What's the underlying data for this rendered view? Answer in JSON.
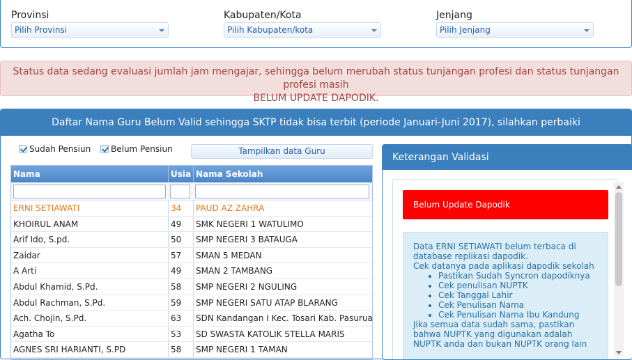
{
  "filters": {
    "provinsi": {
      "label": "Provinsi",
      "value": "Pilih Provinsi"
    },
    "kabupaten": {
      "label": "Kabupaten/Kota",
      "value": "Pilih Kabupaten/kota"
    },
    "jenjang": {
      "label": "Jenjang",
      "value": "Pilih Jenjang"
    }
  },
  "alert": {
    "line1": "Status data sedang evaluasi jumlah jam mengajar, sehingga belum merubah status tunjangan profesi dan status tunjangan profesi masih",
    "line2": "BELUM UPDATE DAPODIK."
  },
  "main": {
    "title": "Daftar Nama Guru Belum Valid sehingga SKTP tidak bisa terbit (periode Januari-Juni 2017), silahkan perbaiki",
    "checkbox_sudah": "Sudah Pensiun",
    "checkbox_belum": "Belum Pensiun",
    "button": "Tampilkan data Guru"
  },
  "table": {
    "columns": [
      "Nama",
      "Usia",
      "Nama Sekolah"
    ],
    "rows": [
      [
        "ERNI SETIAWATI",
        "34",
        "PAUD AZ ZAHRA"
      ],
      [
        "KHOIRUL ANAM",
        "49",
        "SMK NEGERI 1 WATULIMO"
      ],
      [
        "Arif Ido, S.pd.",
        "50",
        "SMP NEGERI 3 BATAUGA"
      ],
      [
        "Zaidar",
        "57",
        "SMAN 5 MEDAN"
      ],
      [
        "A Arti",
        "49",
        "SMAN 2 TAMBANG"
      ],
      [
        "Abdul Khamid, S.Pd.",
        "58",
        "SMP NEGERI 2 NGULING"
      ],
      [
        "Abdul Rachman, S.Pd.",
        "59",
        "SMP NEGERI SATU ATAP BLARANG"
      ],
      [
        "Ach. Chojin, S.Pd.",
        "63",
        "SDN Kandangan I Kec. Tosari Kab. Pasuruan"
      ],
      [
        "Agatha To",
        "53",
        "SD SWASTA KATOLIK STELLA MARIS"
      ],
      [
        "AGNES SRI HARIANTI, S.PD",
        "58",
        "SMP NEGERI 1 TAMAN"
      ]
    ]
  },
  "side": {
    "title": "Keterangan Validasi",
    "status": "Belum Update Dapodik",
    "info_p1": "Data ERNI SETIAWATI belum terbaca di database replikasi dapodik.",
    "info_p2": "Cek datanya pada aplikasi dapodik sekolah",
    "info_items": [
      "Pastikan Sudah Syncron dapodiknya",
      "Cek penulisan NUPTK",
      "Cek Tanggal Lahir",
      "Cek Penulisan Nama",
      "Cek Penulisan Nama Ibu Kandung"
    ],
    "info_p3": "Jika semua data sudah sama, pastikan bahwa NUPTK yang digunakan adalah NUPTK anda dan bukan NUPTK orang lain"
  }
}
